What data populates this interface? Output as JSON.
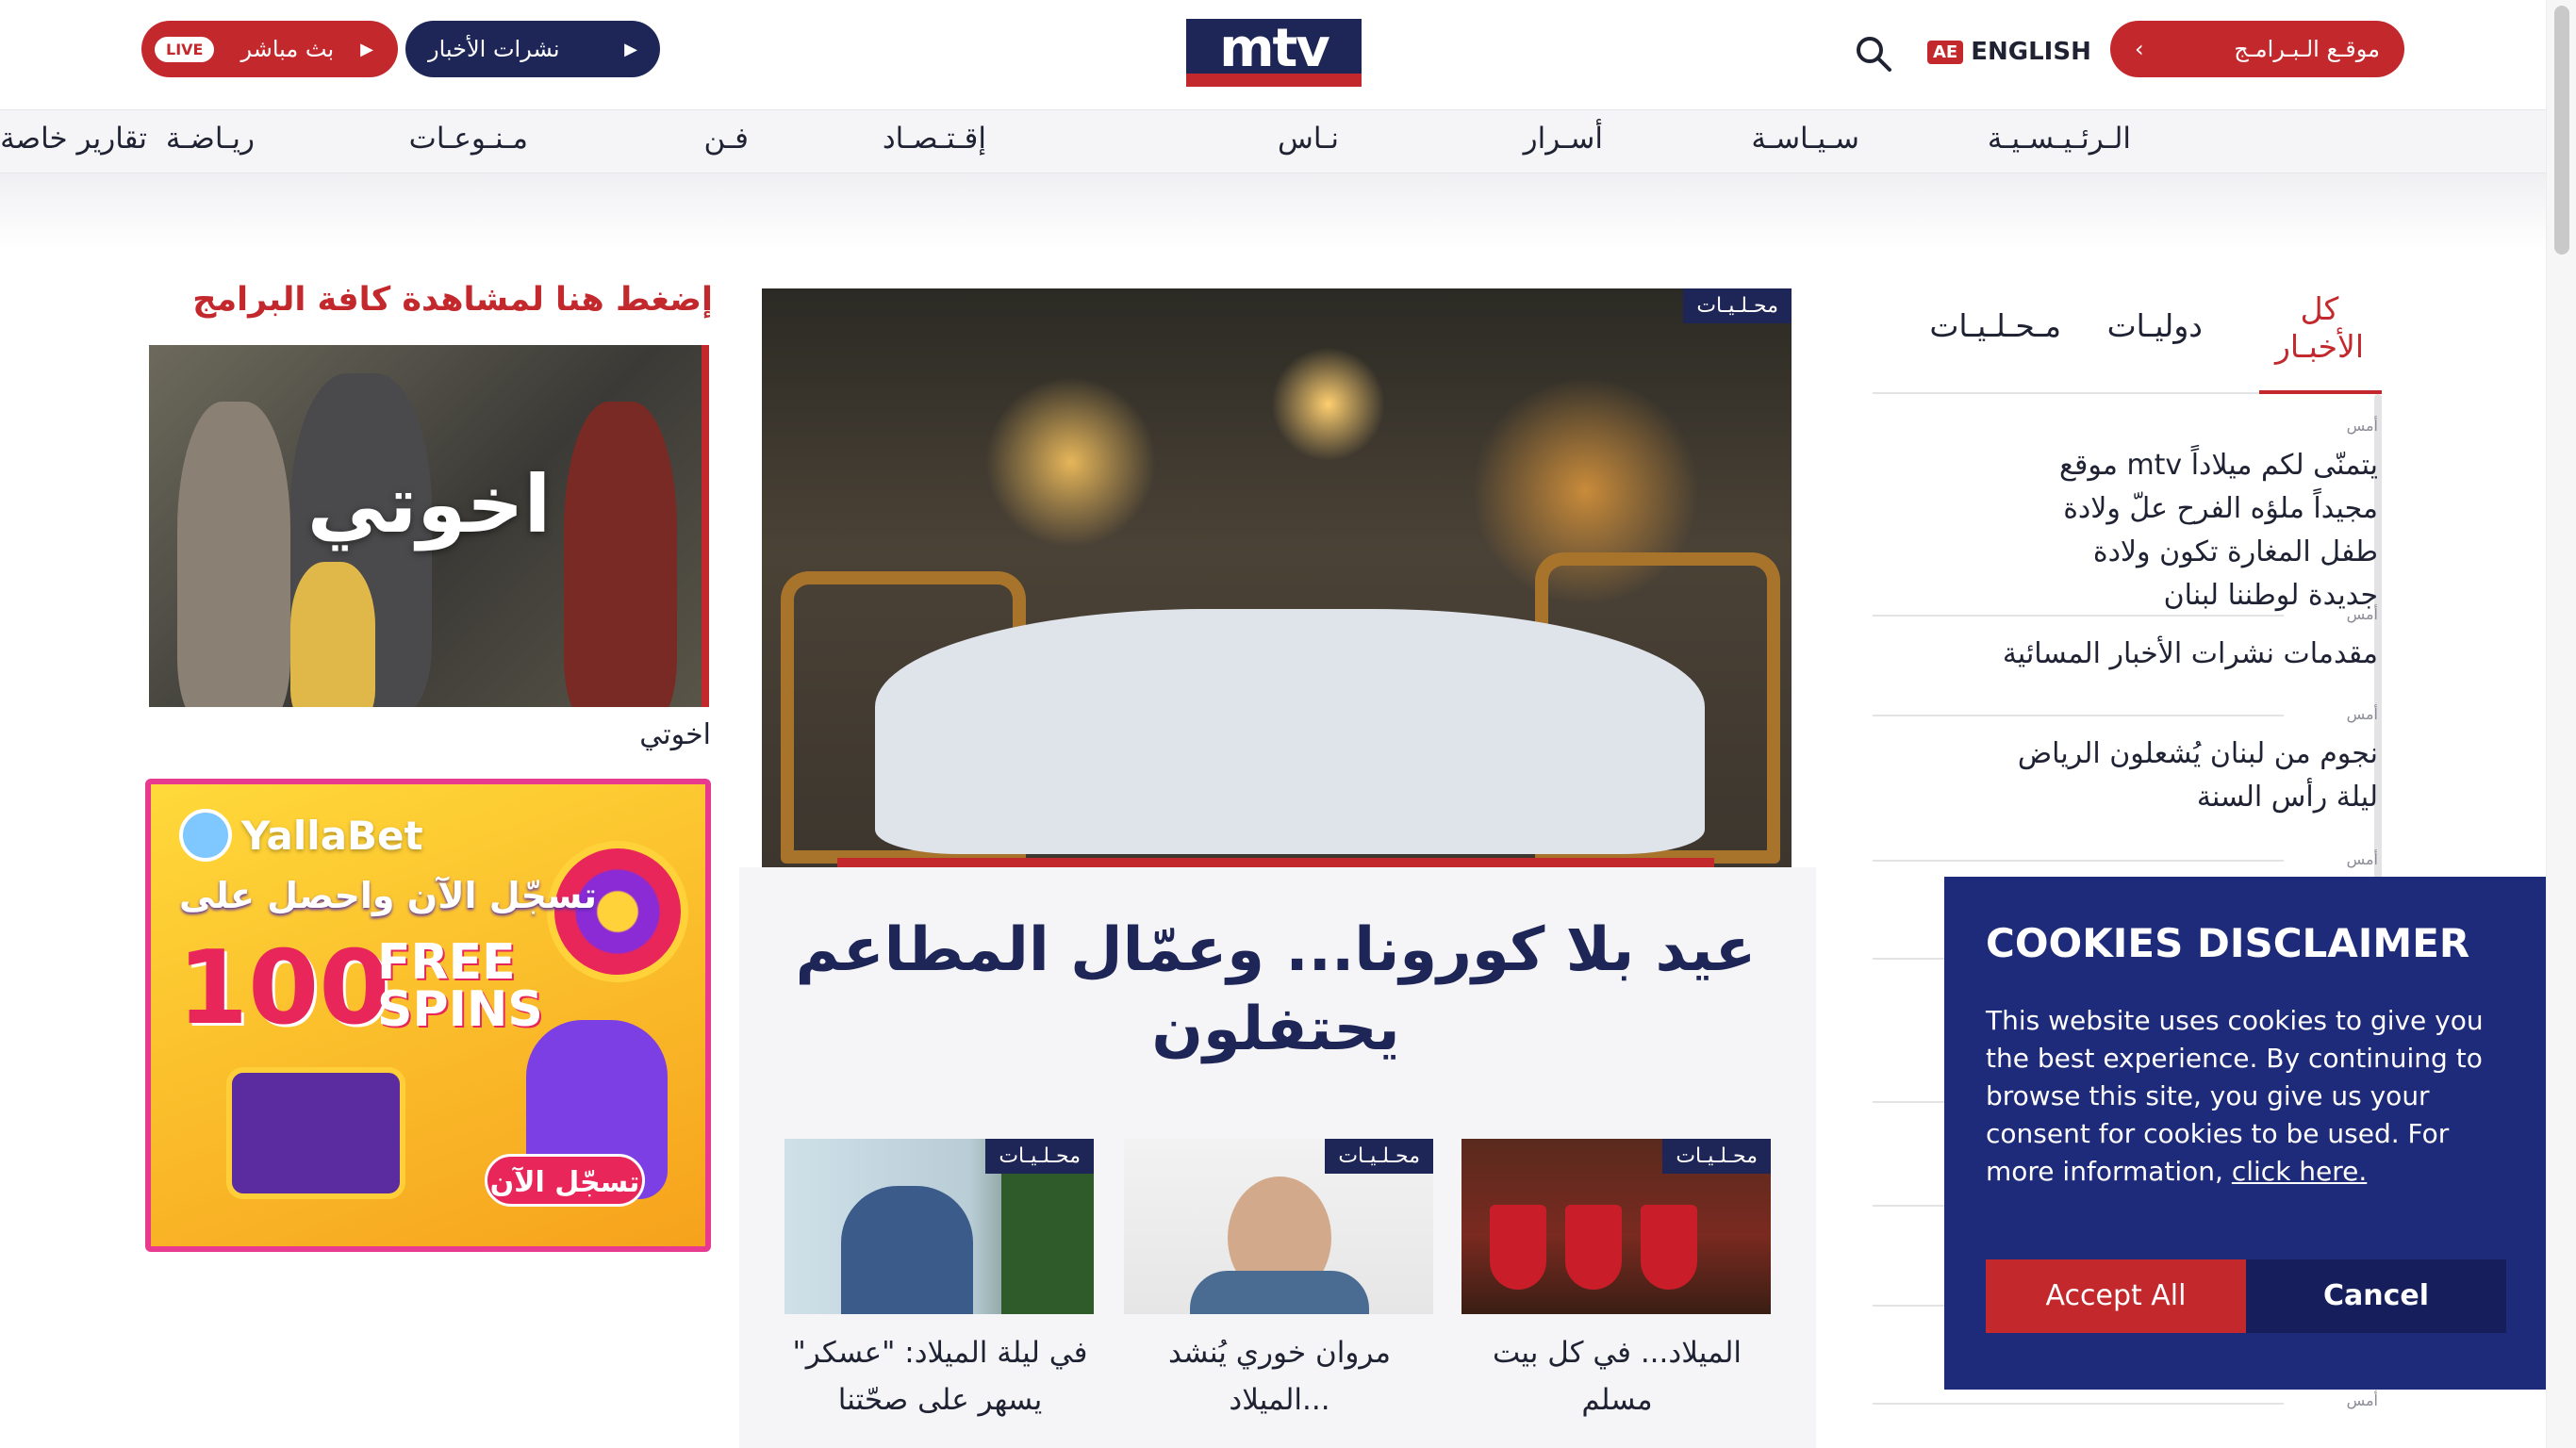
{
  "header": {
    "live_button": {
      "label": "بث مباشر",
      "badge": "LIVE"
    },
    "news_button": {
      "label": "نشرات الأخبار"
    },
    "logo_text": "mtv",
    "language": {
      "badge": "AE",
      "label": "ENGLISH"
    },
    "programs_button": {
      "label": "موقـع الـبـرامـج"
    }
  },
  "nav": {
    "items": [
      "الـرئـيـسـيـة",
      "سـيـاسـة",
      "أسـرار",
      "نـاس",
      "إقـتـصـاد",
      "فـن",
      "مـنـوعـات",
      "ريـاضـة",
      "تقارير خاصة"
    ]
  },
  "promo": {
    "title": "إضغط هنا لمشاهدة كافة البرامج",
    "show_image_text": "اخوتي",
    "show_caption": "اخوتي"
  },
  "ad": {
    "brand": "YallaBet",
    "headline": "تسجّل الآن واحصل على",
    "number": "100",
    "free": "FREE",
    "spins": "SPINS",
    "cta": "تسجّل الآن"
  },
  "hero": {
    "tag": "محـلـيـات",
    "title": "عيد بلا كورونا... وعمّال المطاعم يحتفلون"
  },
  "thumbs": [
    {
      "tag": "محـلـيـات",
      "caption": "الميلاد... في كل بيت مسلم"
    },
    {
      "tag": "محـلـيـات",
      "caption": "مروان خوري يُنشد الميلاد..."
    },
    {
      "tag": "محـلـيـات",
      "caption": "في ليلة الميلاد: \"عسكر\" يسهر على صحّتنا"
    }
  ],
  "tabs": {
    "all": "كل الأخبـار",
    "international": "دوليـات",
    "local": "مـحـلـيـات"
  },
  "news": [
    {
      "time": "أمس",
      "title": "موقع mtv يتمنّى لكم ميلاداً مجيداً ملؤه الفرح علّ ولادة طفل المغارة تكون ولادة جديدة لوطننا لبنان"
    },
    {
      "time": "أمس",
      "title": "مقدمات نشرات الأخبار المسائية"
    },
    {
      "time": "أمس",
      "title": "نجوم من لبنان يُشعلون الرياض ليلة رأس السنة"
    },
    {
      "time": "أمس",
      "title": ""
    },
    {
      "time": "أمس",
      "title": ""
    }
  ],
  "cookie": {
    "title": "COOKIES DISCLAIMER",
    "body": "This website uses cookies to give you the best experience. By continuing to browse this site, you give us your consent for cookies to be used. For more information,",
    "link": "click here.",
    "accept": "Accept All",
    "cancel": "Cancel"
  },
  "colors": {
    "brand_red": "#c3282c",
    "brand_navy": "#1e2557",
    "cookie_bg": "#1e2a7a"
  },
  "icons": [
    "search-icon",
    "play-icon",
    "chevron-left-icon"
  ]
}
